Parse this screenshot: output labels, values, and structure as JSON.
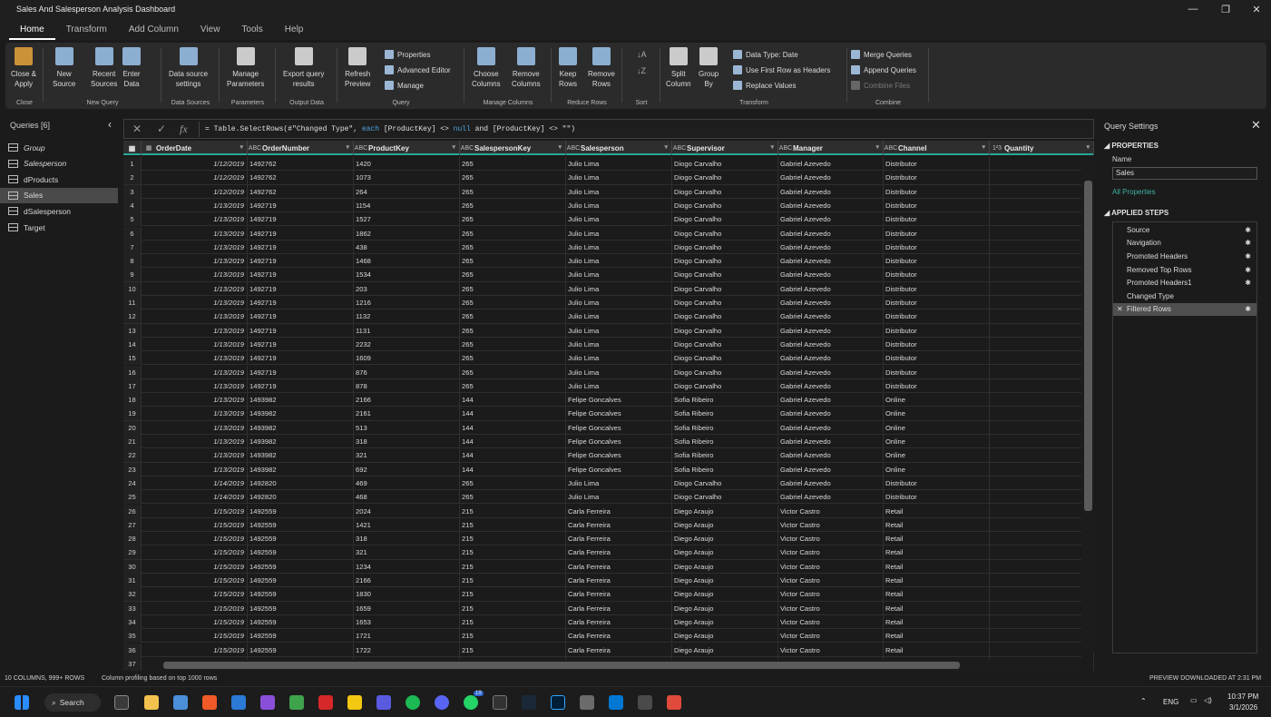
{
  "window": {
    "title": "Sales And Salesperson Analysis Dashboard"
  },
  "menu_tabs": [
    "Home",
    "Transform",
    "Add Column",
    "View",
    "Tools",
    "Help"
  ],
  "ribbon": {
    "groups": [
      {
        "label": "Close",
        "buttons": [
          "Close &\nApply"
        ]
      },
      {
        "label": "New Query",
        "buttons": [
          "New\nSource",
          "Recent\nSources",
          "Enter\nData"
        ]
      },
      {
        "label": "Data Sources",
        "buttons": [
          "Data source\nsettings"
        ]
      },
      {
        "label": "Parameters",
        "buttons": [
          "Manage\nParameters"
        ]
      },
      {
        "label": "Output Data",
        "buttons": [
          "Export query\nresults"
        ]
      },
      {
        "label": "Query",
        "buttons": [
          "Refresh\nPreview"
        ],
        "small": [
          "Properties",
          "Advanced Editor",
          "Manage"
        ]
      },
      {
        "label": "Manage Columns",
        "buttons": [
          "Choose\nColumns",
          "Remove\nColumns"
        ]
      },
      {
        "label": "Reduce Rows",
        "buttons": [
          "Keep\nRows",
          "Remove\nRows"
        ]
      },
      {
        "label": "Sort",
        "buttons": []
      },
      {
        "label": "Transform",
        "buttons": [
          "Split\nColumn",
          "Group\nBy"
        ],
        "small": [
          "Data Type: Date",
          "Use First Row as Headers",
          "Replace Values"
        ]
      },
      {
        "label": "Combine",
        "buttons": [],
        "small": [
          "Merge Queries",
          "Append Queries",
          "Combine Files"
        ]
      }
    ]
  },
  "queries": {
    "header": "Queries [6]",
    "items": [
      {
        "label": "Group",
        "italic": true
      },
      {
        "label": "Salesperson",
        "italic": true
      },
      {
        "label": "dProducts"
      },
      {
        "label": "Sales",
        "selected": true
      },
      {
        "label": "dSalesperson"
      },
      {
        "label": "Target"
      }
    ]
  },
  "formula": {
    "pre": "= Table.SelectRows(#\"Changed Type\", ",
    "kw1": "each",
    "mid": " [ProductKey] <> ",
    "kw2": "null",
    "post": " and [ProductKey] <> \"\")"
  },
  "columns": [
    {
      "name": "OrderDate",
      "type": "▦"
    },
    {
      "name": "OrderNumber",
      "type": "ABC"
    },
    {
      "name": "ProductKey",
      "type": "ABC"
    },
    {
      "name": "SalespersonKey",
      "type": "ABC"
    },
    {
      "name": "Salesperson",
      "type": "ABC"
    },
    {
      "name": "Supervisor",
      "type": "ABC"
    },
    {
      "name": "Manager",
      "type": "ABC"
    },
    {
      "name": "Channel",
      "type": "ABC"
    },
    {
      "name": "Quantity",
      "type": "1²3"
    }
  ],
  "rows": [
    [
      "1/12/2019",
      "1492762",
      "1420",
      "265",
      "Julio Lima",
      "Diogo Carvalho",
      "Gabriel Azevedo",
      "Distributor"
    ],
    [
      "1/12/2019",
      "1492762",
      "1073",
      "265",
      "Julio Lima",
      "Diogo Carvalho",
      "Gabriel Azevedo",
      "Distributor"
    ],
    [
      "1/12/2019",
      "1492762",
      "264",
      "265",
      "Julio Lima",
      "Diogo Carvalho",
      "Gabriel Azevedo",
      "Distributor"
    ],
    [
      "1/13/2019",
      "1492719",
      "1154",
      "265",
      "Julio Lima",
      "Diogo Carvalho",
      "Gabriel Azevedo",
      "Distributor"
    ],
    [
      "1/13/2019",
      "1492719",
      "1527",
      "265",
      "Julio Lima",
      "Diogo Carvalho",
      "Gabriel Azevedo",
      "Distributor"
    ],
    [
      "1/13/2019",
      "1492719",
      "1862",
      "265",
      "Julio Lima",
      "Diogo Carvalho",
      "Gabriel Azevedo",
      "Distributor"
    ],
    [
      "1/13/2019",
      "1492719",
      "438",
      "265",
      "Julio Lima",
      "Diogo Carvalho",
      "Gabriel Azevedo",
      "Distributor"
    ],
    [
      "1/13/2019",
      "1492719",
      "1468",
      "265",
      "Julio Lima",
      "Diogo Carvalho",
      "Gabriel Azevedo",
      "Distributor"
    ],
    [
      "1/13/2019",
      "1492719",
      "1534",
      "265",
      "Julio Lima",
      "Diogo Carvalho",
      "Gabriel Azevedo",
      "Distributor"
    ],
    [
      "1/13/2019",
      "1492719",
      "203",
      "265",
      "Julio Lima",
      "Diogo Carvalho",
      "Gabriel Azevedo",
      "Distributor"
    ],
    [
      "1/13/2019",
      "1492719",
      "1216",
      "265",
      "Julio Lima",
      "Diogo Carvalho",
      "Gabriel Azevedo",
      "Distributor"
    ],
    [
      "1/13/2019",
      "1492719",
      "1132",
      "265",
      "Julio Lima",
      "Diogo Carvalho",
      "Gabriel Azevedo",
      "Distributor"
    ],
    [
      "1/13/2019",
      "1492719",
      "1131",
      "265",
      "Julio Lima",
      "Diogo Carvalho",
      "Gabriel Azevedo",
      "Distributor"
    ],
    [
      "1/13/2019",
      "1492719",
      "2232",
      "265",
      "Julio Lima",
      "Diogo Carvalho",
      "Gabriel Azevedo",
      "Distributor"
    ],
    [
      "1/13/2019",
      "1492719",
      "1609",
      "265",
      "Julio Lima",
      "Diogo Carvalho",
      "Gabriel Azevedo",
      "Distributor"
    ],
    [
      "1/13/2019",
      "1492719",
      "876",
      "265",
      "Julio Lima",
      "Diogo Carvalho",
      "Gabriel Azevedo",
      "Distributor"
    ],
    [
      "1/13/2019",
      "1492719",
      "878",
      "265",
      "Julio Lima",
      "Diogo Carvalho",
      "Gabriel Azevedo",
      "Distributor"
    ],
    [
      "1/13/2019",
      "1493982",
      "2166",
      "144",
      "Felipe Goncalves",
      "Sofia Ribeiro",
      "Gabriel Azevedo",
      "Online"
    ],
    [
      "1/13/2019",
      "1493982",
      "2161",
      "144",
      "Felipe Goncalves",
      "Sofia Ribeiro",
      "Gabriel Azevedo",
      "Online"
    ],
    [
      "1/13/2019",
      "1493982",
      "513",
      "144",
      "Felipe Goncalves",
      "Sofia Ribeiro",
      "Gabriel Azevedo",
      "Online"
    ],
    [
      "1/13/2019",
      "1493982",
      "318",
      "144",
      "Felipe Goncalves",
      "Sofia Ribeiro",
      "Gabriel Azevedo",
      "Online"
    ],
    [
      "1/13/2019",
      "1493982",
      "321",
      "144",
      "Felipe Goncalves",
      "Sofia Ribeiro",
      "Gabriel Azevedo",
      "Online"
    ],
    [
      "1/13/2019",
      "1493982",
      "692",
      "144",
      "Felipe Goncalves",
      "Sofia Ribeiro",
      "Gabriel Azevedo",
      "Online"
    ],
    [
      "1/14/2019",
      "1492820",
      "469",
      "265",
      "Julio Lima",
      "Diogo Carvalho",
      "Gabriel Azevedo",
      "Distributor"
    ],
    [
      "1/14/2019",
      "1492820",
      "468",
      "265",
      "Julio Lima",
      "Diogo Carvalho",
      "Gabriel Azevedo",
      "Distributor"
    ],
    [
      "1/15/2019",
      "1492559",
      "2024",
      "215",
      "Carla Ferreira",
      "Diego Araujo",
      "Victor Castro",
      "Retail"
    ],
    [
      "1/15/2019",
      "1492559",
      "1421",
      "215",
      "Carla Ferreira",
      "Diego Araujo",
      "Victor Castro",
      "Retail"
    ],
    [
      "1/15/2019",
      "1492559",
      "318",
      "215",
      "Carla Ferreira",
      "Diego Araujo",
      "Victor Castro",
      "Retail"
    ],
    [
      "1/15/2019",
      "1492559",
      "321",
      "215",
      "Carla Ferreira",
      "Diego Araujo",
      "Victor Castro",
      "Retail"
    ],
    [
      "1/15/2019",
      "1492559",
      "1234",
      "215",
      "Carla Ferreira",
      "Diego Araujo",
      "Victor Castro",
      "Retail"
    ],
    [
      "1/15/2019",
      "1492559",
      "2166",
      "215",
      "Carla Ferreira",
      "Diego Araujo",
      "Victor Castro",
      "Retail"
    ],
    [
      "1/15/2019",
      "1492559",
      "1830",
      "215",
      "Carla Ferreira",
      "Diego Araujo",
      "Victor Castro",
      "Retail"
    ],
    [
      "1/15/2019",
      "1492559",
      "1659",
      "215",
      "Carla Ferreira",
      "Diego Araujo",
      "Victor Castro",
      "Retail"
    ],
    [
      "1/15/2019",
      "1492559",
      "1653",
      "215",
      "Carla Ferreira",
      "Diego Araujo",
      "Victor Castro",
      "Retail"
    ],
    [
      "1/15/2019",
      "1492559",
      "1721",
      "215",
      "Carla Ferreira",
      "Diego Araujo",
      "Victor Castro",
      "Retail"
    ],
    [
      "1/15/2019",
      "1492559",
      "1722",
      "215",
      "Carla Ferreira",
      "Diego Araujo",
      "Victor Castro",
      "Retail"
    ],
    [
      "",
      "",
      "",
      "",
      "",
      "",
      "",
      ""
    ]
  ],
  "settings": {
    "title": "Query Settings",
    "properties": "PROPERTIES",
    "name_label": "Name",
    "name_value": "Sales",
    "all_properties": "All Properties",
    "applied_steps": "APPLIED STEPS",
    "steps": [
      {
        "label": "Source",
        "gear": true
      },
      {
        "label": "Navigation",
        "gear": true
      },
      {
        "label": "Promoted Headers",
        "gear": true
      },
      {
        "label": "Removed Top Rows",
        "gear": true
      },
      {
        "label": "Promoted Headers1",
        "gear": true
      },
      {
        "label": "Changed Type",
        "gear": false
      },
      {
        "label": "Filtered Rows",
        "gear": true,
        "selected": true
      }
    ]
  },
  "status": {
    "left": "10 COLUMNS, 999+ ROWS",
    "middle": "Column profiling based on top 1000 rows",
    "right": "PREVIEW DOWNLOADED AT 2:31 PM"
  },
  "taskbar": {
    "search": "Search",
    "lang": "ENG",
    "time": "10:37 PM",
    "date": "3/1/2026",
    "badge": "19"
  },
  "colors": {
    "accent": "#25a89a",
    "link": "#3db1a3",
    "keyword": "#4fa3e0"
  }
}
